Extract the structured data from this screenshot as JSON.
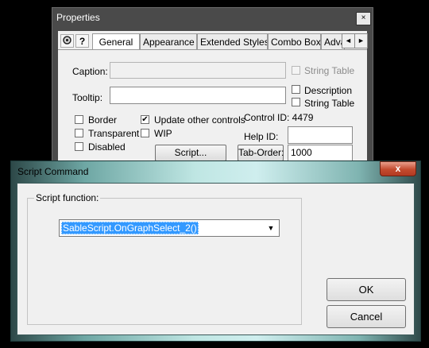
{
  "properties_window": {
    "title": "Properties",
    "close_glyph": "×",
    "tabs": [
      "General",
      "Appearance",
      "Extended Styles",
      "Combo Box",
      "Adva"
    ],
    "scroll_left": "◄",
    "scroll_right": "►",
    "pin_icon": "pushpin-icon",
    "help_icon": "help-icon",
    "help_glyph": "?",
    "caption_label": "Caption:",
    "caption_value": "",
    "string_table_label": "String Table",
    "tooltip_label": "Tooltip:",
    "tooltip_value": "",
    "description_label": "Description",
    "string_table2_label": "String Table",
    "border_label": "Border",
    "transparent_label": "Transparent",
    "disabled_label": "Disabled",
    "update_controls_label": "Update other controls",
    "update_controls_checked": true,
    "wip_label": "WIP",
    "control_id_label": "Control ID: 4479",
    "help_id_label": "Help ID:",
    "help_id_value": "",
    "script_button": "Script...",
    "tab_order_button": "Tab-Order:",
    "tab_order_value": "1000",
    "check_glyph": "✔"
  },
  "script_dialog": {
    "title": "Script Command",
    "close_glyph": "x",
    "group_label": "Script function:",
    "function_value": "SableScript.OnGraphSelect_2()",
    "dropdown_glyph": "▼",
    "ok_button": "OK",
    "cancel_button": "Cancel"
  },
  "colors": {
    "selection": "#3399ff",
    "close_button": "#c24a2e"
  }
}
